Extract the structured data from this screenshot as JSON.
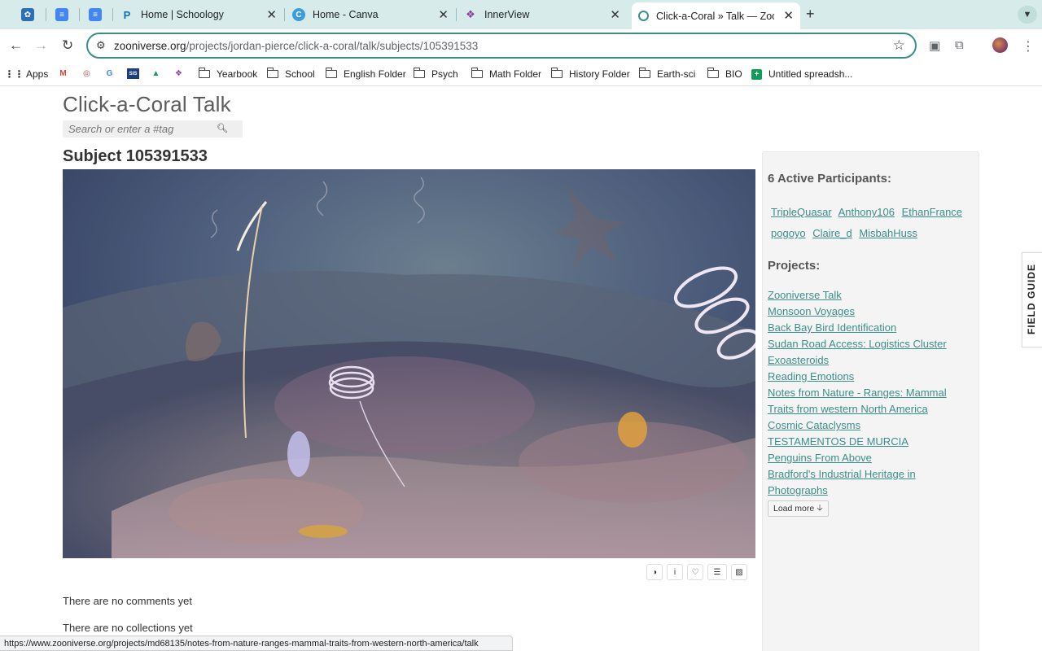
{
  "tabs": [
    {
      "title": "",
      "icon": "mushroom-app-icon",
      "color": "#2d6fb6"
    },
    {
      "title": "",
      "icon": "docs-icon",
      "color": "#4285f4"
    },
    {
      "title": "",
      "icon": "docs-icon",
      "color": "#4285f4"
    },
    {
      "title": "Home | Schoology",
      "icon": "schoology-icon",
      "color": "#0d6eb8"
    },
    {
      "title": "Home - Canva",
      "icon": "canva-icon",
      "color": "#3a9de0"
    },
    {
      "title": "InnerView",
      "icon": "innerview-icon",
      "color": "#8a3d9e"
    },
    {
      "title": "Click-a-Coral » Talk — Zooniv",
      "icon": "zooniverse-icon",
      "color": "#3a8f8a",
      "active": true
    }
  ],
  "address_bar": {
    "domain": "zooniverse.org",
    "path": "/projects/jordan-pierce/click-a-coral/talk/subjects/105391533"
  },
  "bookmarks": [
    {
      "label": "Apps",
      "type": "apps-icon"
    },
    {
      "label": "",
      "type": "gmail-icon"
    },
    {
      "label": "",
      "type": "site-icon"
    },
    {
      "label": "",
      "type": "google-icon"
    },
    {
      "label": "",
      "type": "sis-icon"
    },
    {
      "label": "",
      "type": "drive-icon"
    },
    {
      "label": "",
      "type": "site-icon"
    },
    {
      "label": "Yearbook",
      "type": "folder-icon"
    },
    {
      "label": "School",
      "type": "folder-icon"
    },
    {
      "label": "English Folder",
      "type": "folder-icon"
    },
    {
      "label": "Psych",
      "type": "folder-icon"
    },
    {
      "label": "Math Folder",
      "type": "folder-icon"
    },
    {
      "label": "History Folder",
      "type": "folder-icon"
    },
    {
      "label": "Earth-sci",
      "type": "folder-icon"
    },
    {
      "label": "BIO",
      "type": "folder-icon"
    },
    {
      "label": "Untitled spreadsh...",
      "type": "sheets-icon"
    }
  ],
  "page": {
    "talk_title": "Click-a-Coral Talk",
    "search_placeholder": "Search or enter a #tag",
    "subject_title": "Subject 105391533",
    "no_comments": "There are no comments yet",
    "no_collections": "There are no collections yet"
  },
  "sidebar": {
    "participants_heading": "6 Active Participants:",
    "participants": [
      "TripleQuasar",
      "Anthony106",
      "EthanFrance",
      "pogoyo",
      "Claire_d",
      "MisbahHuss"
    ],
    "projects_heading": "Projects:",
    "projects": [
      "Zooniverse Talk",
      "Monsoon Voyages",
      "Back Bay Bird Identification",
      "Sudan Road Access: Logistics Cluster",
      "Exoasteroids",
      "Reading Emotions",
      "Notes from Nature - Ranges: Mammal ",
      "Traits from western North America",
      "Cosmic Cataclysms ",
      "TESTAMENTOS DE MURCIA",
      "Penguins From Above",
      "Bradford's Industrial Heritage in ",
      "Photographs"
    ],
    "load_more": "Load more"
  },
  "field_guide": "FIELD GUIDE",
  "status_url": "https://www.zooniverse.org/projects/md68135/notes-from-nature-ranges-mammal-traits-from-western-north-america/talk",
  "colors": {
    "accent": "#3a8f8a",
    "tabstrip": "#d7ecea",
    "title_grey": "#5c5c5c"
  }
}
